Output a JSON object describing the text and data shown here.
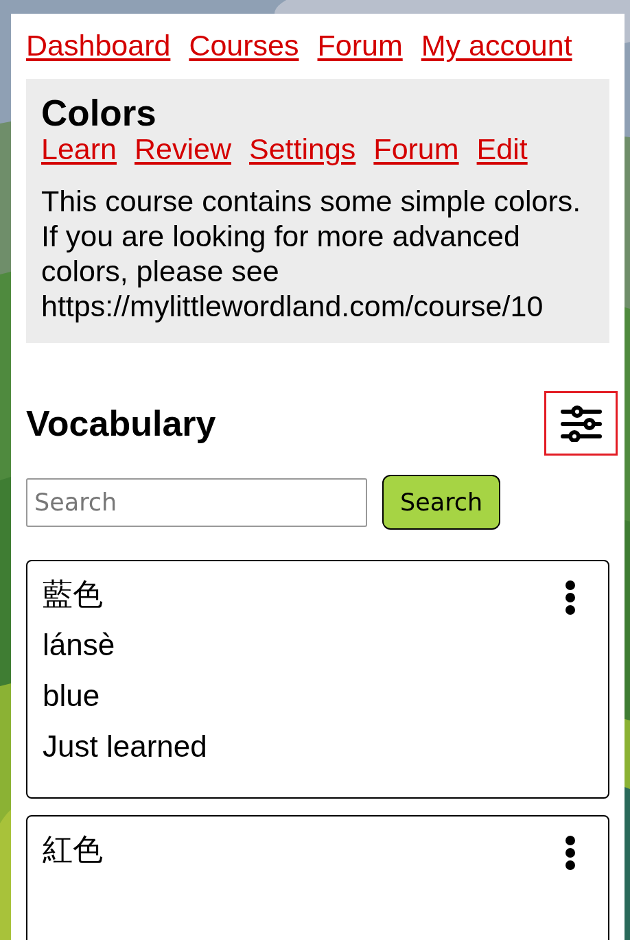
{
  "nav": [
    {
      "label": "Dashboard"
    },
    {
      "label": "Courses"
    },
    {
      "label": "Forum"
    },
    {
      "label": "My account"
    }
  ],
  "course": {
    "title": "Colors",
    "links": [
      {
        "label": "Learn"
      },
      {
        "label": "Review"
      },
      {
        "label": "Settings"
      },
      {
        "label": "Forum"
      },
      {
        "label": "Edit"
      }
    ],
    "description": "This course contains some simple colors. If you are looking for more advanced colors, please see https://mylittlewordland.com/course/10"
  },
  "vocabulary": {
    "heading": "Vocabulary",
    "filter_button": {
      "focused": true
    },
    "search": {
      "placeholder": "Search",
      "button": "Search"
    },
    "cards": [
      {
        "word": "藍色",
        "pinyin": "lánsè",
        "meaning": "blue",
        "status": "Just learned"
      },
      {
        "word": "紅色"
      }
    ]
  }
}
